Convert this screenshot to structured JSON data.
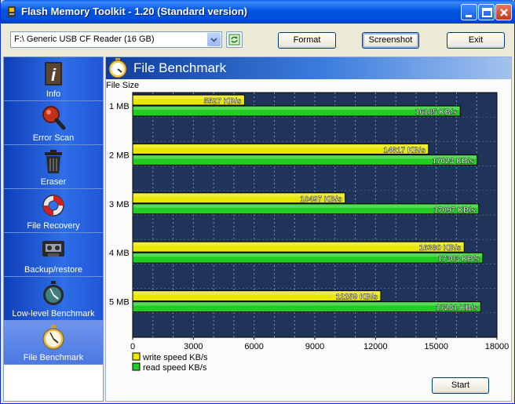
{
  "window": {
    "title": "Flash Memory Toolkit - 1.20 (Standard version)"
  },
  "toolbar": {
    "drive_value": "F:\\ Generic USB CF Reader (16 GB)",
    "format_label": "Format",
    "screenshot_label": "Screenshot",
    "exit_label": "Exit"
  },
  "sidebar": {
    "items": [
      {
        "label": "Info",
        "icon": "info-book-icon"
      },
      {
        "label": "Error Scan",
        "icon": "magnifier-icon"
      },
      {
        "label": "Eraser",
        "icon": "trash-bin-icon"
      },
      {
        "label": "File Recovery",
        "icon": "lifebuoy-icon"
      },
      {
        "label": "Backup/restore",
        "icon": "tape-cassette-icon"
      },
      {
        "label": "Low-level Benchmark",
        "icon": "stopwatch-icon"
      },
      {
        "label": "File Benchmark",
        "icon": "stopwatch-yellow-icon"
      }
    ],
    "active_index": 6
  },
  "panel": {
    "title": "File Benchmark",
    "start_label": "Start"
  },
  "chart_data": {
    "type": "bar",
    "orientation": "horizontal",
    "ylabel": "File Size",
    "categories": [
      "1 MB",
      "2 MB",
      "3 MB",
      "4 MB",
      "5 MB"
    ],
    "series": [
      {
        "name": "write speed KB/s",
        "color": "#e8e800",
        "values": [
          5527,
          14617,
          10497,
          16380,
          12259
        ]
      },
      {
        "name": "read speed KB/s",
        "color": "#22cc22",
        "values": [
          16185,
          17023,
          17097,
          17303,
          17201
        ]
      }
    ],
    "value_suffix": " KB/s",
    "xlim": [
      0,
      18000
    ],
    "xticks": [
      "0",
      "3000",
      "6000",
      "9000",
      "12000",
      "15000",
      "18000"
    ],
    "grid": true,
    "legend": "bottom-left",
    "background": "#1f3458"
  }
}
